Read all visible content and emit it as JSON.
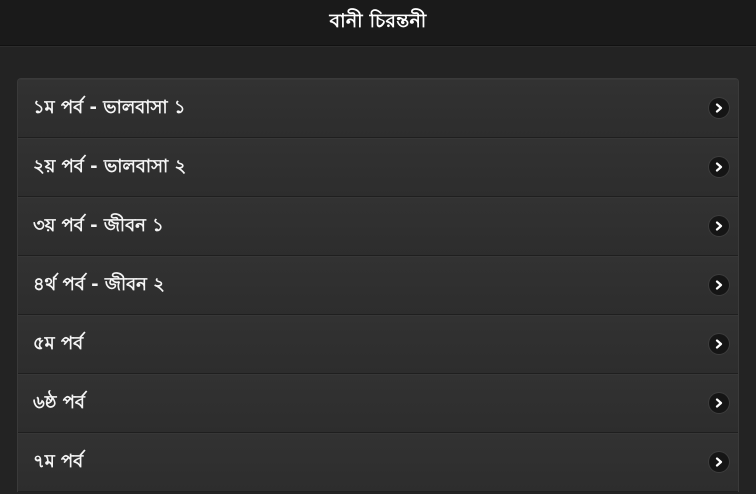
{
  "header": {
    "title": "বানী চিরন্তনী"
  },
  "list": {
    "items": [
      {
        "label": "১ম পর্ব - ভালবাসা ১",
        "icon": "chevron-right-icon"
      },
      {
        "label": "২য় পর্ব - ভালবাসা ২",
        "icon": "chevron-right-icon"
      },
      {
        "label": "৩য় পর্ব - জীবন ১",
        "icon": "chevron-right-icon"
      },
      {
        "label": "৪র্থ পর্ব - জীবন ২",
        "icon": "chevron-right-icon"
      },
      {
        "label": "৫ম পর্ব",
        "icon": "chevron-right-icon"
      },
      {
        "label": "৬ষ্ঠ পর্ব",
        "icon": "chevron-right-icon"
      },
      {
        "label": "৭ম পর্ব",
        "icon": "chevron-right-icon"
      }
    ]
  },
  "colors": {
    "background": "#232323",
    "header_background": "#1a1a1a",
    "list_item_background": "#2f2f2f",
    "text": "#f5f5f5"
  }
}
